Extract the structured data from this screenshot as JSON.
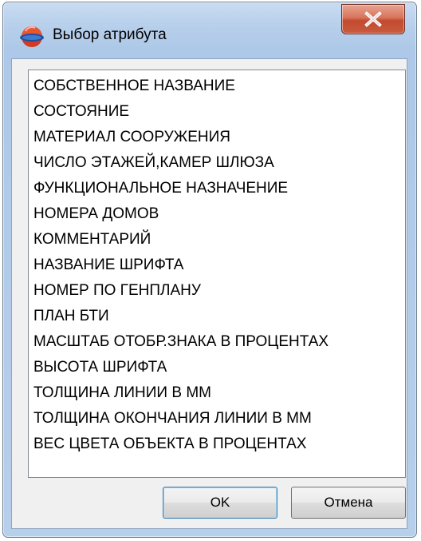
{
  "window": {
    "title": "Выбор атрибута",
    "close_icon": "close-icon"
  },
  "list": {
    "items": [
      "СОБСТВЕННОЕ НАЗВАНИЕ",
      "СОСТОЯНИЕ",
      "МАТЕРИАЛ СООРУЖЕНИЯ",
      "ЧИСЛО ЭТАЖЕЙ,КАМЕР ШЛЮЗА",
      "ФУНКЦИОНАЛЬНОЕ НАЗНАЧЕНИЕ",
      "НОМЕРА ДОМОВ",
      "КОММЕНТАРИЙ",
      "НАЗВАНИЕ ШРИФТА",
      "НОМЕР ПО ГЕНПЛАНУ",
      "ПЛАН БТИ",
      "МАСШТАБ ОТОБР.ЗНАКА В ПРОЦЕНТАХ",
      "ВЫСОТА ШРИФТА",
      "ТОЛЩИНА ЛИНИИ В ММ",
      "ТОЛЩИНА ОКОНЧАНИЯ ЛИНИИ В ММ",
      "ВЕС ЦВЕТА ОБЪЕКТА В ПРОЦЕНТАХ"
    ]
  },
  "buttons": {
    "ok_label": "OK",
    "cancel_label": "Отмена"
  },
  "colors": {
    "title_bar": "#b7cfeb",
    "close_button": "#c9553a",
    "default_button_border": "#3c7fb1"
  }
}
